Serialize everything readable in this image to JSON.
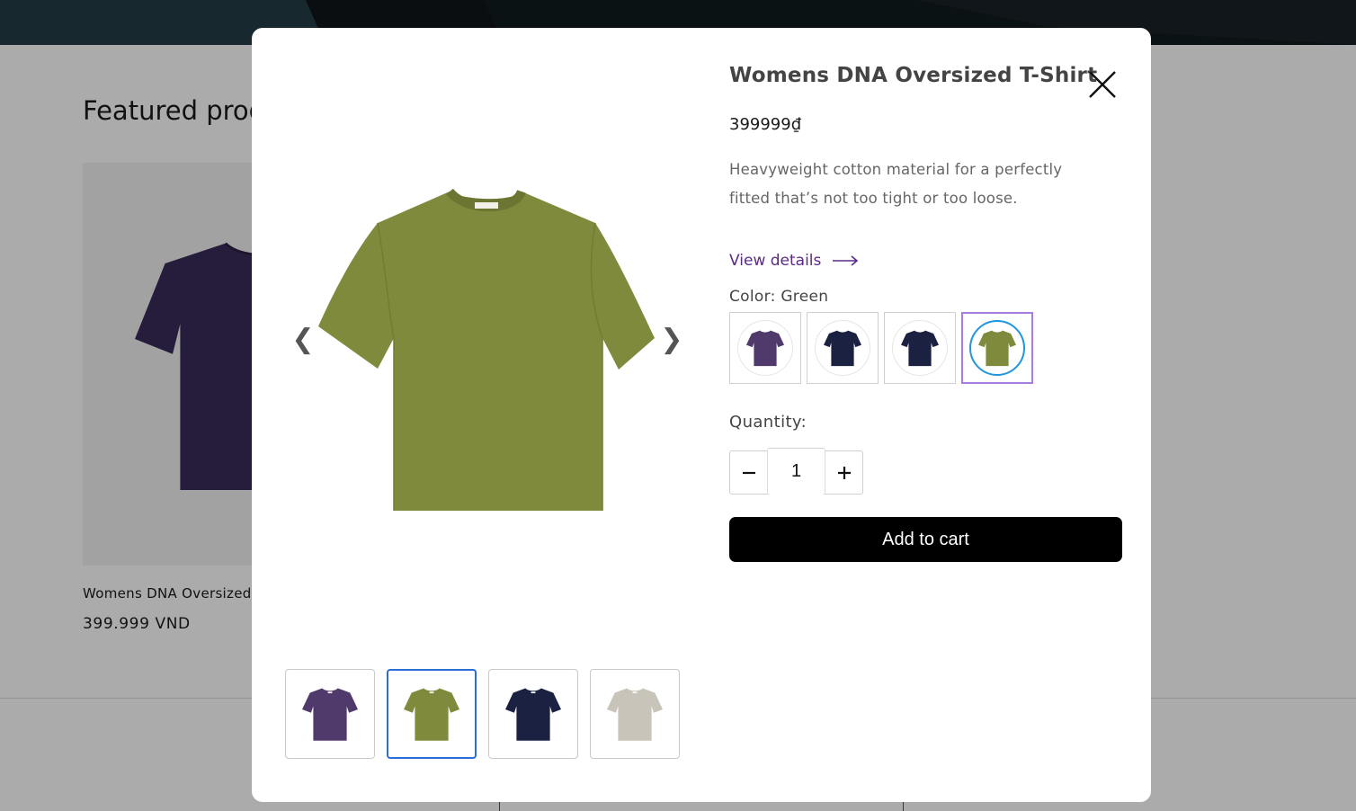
{
  "colors": {
    "purple": "#4f3a6b",
    "navy": "#1b2140",
    "green": "#7f8a3c",
    "sand": "#c9c4ba",
    "bg_purple": "#3a2a58",
    "accent_link": "#5b2a86",
    "swatch_selected_border": "#a77ee0",
    "thumb_active_border": "#2b6dd6"
  },
  "background": {
    "featured_heading": "Featured products",
    "card_title": "Womens DNA Oversized T-Shirt",
    "card_price": "399.999 VND"
  },
  "modal": {
    "title": "Womens DNA Oversized T-Shirt",
    "price": "399999₫",
    "description": "Heavyweight cotton material for a perfectly fitted that’s not too tight or too loose.",
    "view_details": "View details",
    "view_details_icon": "arrow-right-icon",
    "close_icon": "close-icon",
    "prev_arrow": "❮",
    "next_arrow": "❯",
    "color_label": "Color: Green",
    "swatches": [
      "Purple",
      "Navy",
      "Navy",
      "Green"
    ],
    "selected_swatch": "Green",
    "quantity_label": "Quantity:",
    "quantity_value": "1",
    "add_to_cart": "Add to cart",
    "thumbnails": [
      "Purple",
      "Green",
      "Navy",
      "Sand"
    ],
    "active_thumbnail": "Green"
  }
}
